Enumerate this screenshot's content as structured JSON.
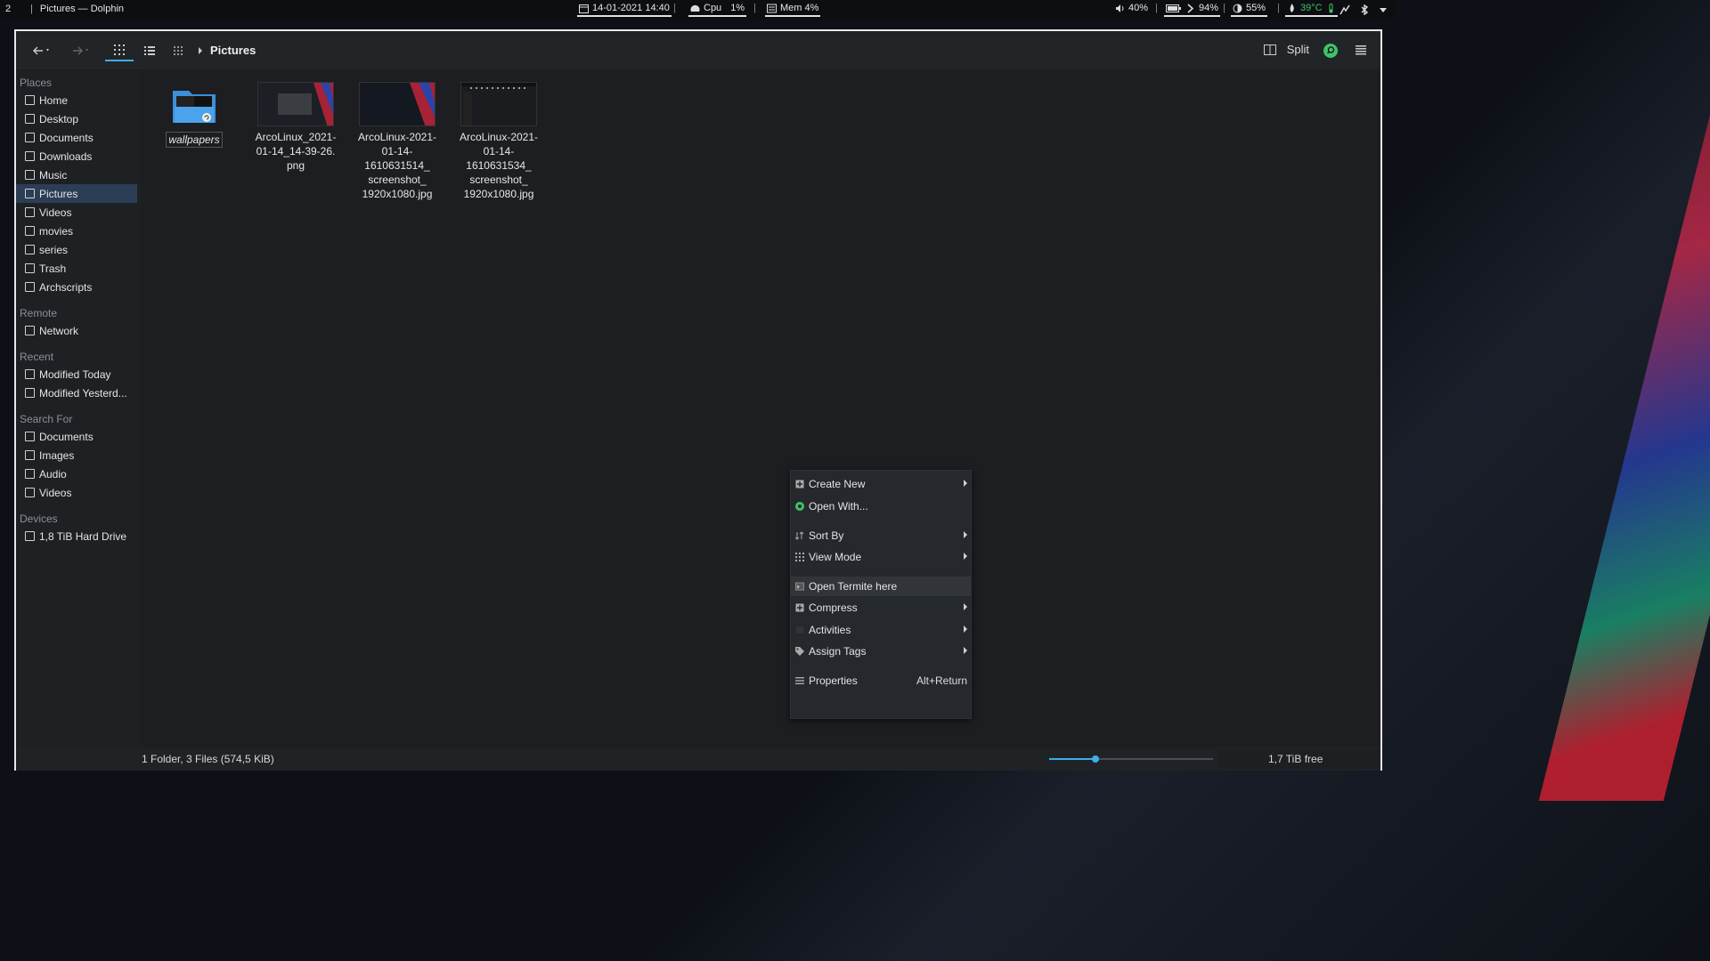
{
  "topbar": {
    "workspace": "2",
    "window_title": "Pictures — Dolphin",
    "date": "14-01-2021 14:40",
    "cpu_label": "Cpu",
    "cpu_value": "1%",
    "mem": "Mem 4%",
    "volume": "40%",
    "battery": "94%",
    "brightness": "55%",
    "temperature": "39°C",
    "temperature_color": "#3ec36b"
  },
  "toolbar": {
    "breadcrumb": "Pictures",
    "split_label": "Split"
  },
  "sidebar": {
    "places_title": "Places",
    "places": [
      {
        "label": "Home",
        "icon": "home-icon"
      },
      {
        "label": "Desktop",
        "icon": "desktop-icon"
      },
      {
        "label": "Documents",
        "icon": "document-icon"
      },
      {
        "label": "Downloads",
        "icon": "download-icon"
      },
      {
        "label": "Music",
        "icon": "music-icon"
      },
      {
        "label": "Pictures",
        "icon": "image-icon",
        "selected": true
      },
      {
        "label": "Videos",
        "icon": "video-icon"
      },
      {
        "label": "movies",
        "icon": "folder-icon"
      },
      {
        "label": "series",
        "icon": "folder-icon"
      },
      {
        "label": "Trash",
        "icon": "trash-icon"
      },
      {
        "label": "Archscripts",
        "icon": "folder-icon"
      }
    ],
    "remote_title": "Remote",
    "remote": [
      {
        "label": "Network",
        "icon": "network-icon"
      }
    ],
    "recent_title": "Recent",
    "recent": [
      {
        "label": "Modified Today",
        "icon": "calendar-icon"
      },
      {
        "label": "Modified Yesterd...",
        "icon": "calendar-icon"
      }
    ],
    "search_title": "Search For",
    "search": [
      {
        "label": "Documents",
        "icon": "document-icon"
      },
      {
        "label": "Images",
        "icon": "image-icon"
      },
      {
        "label": "Audio",
        "icon": "music-icon"
      },
      {
        "label": "Videos",
        "icon": "video-icon"
      }
    ],
    "devices_title": "Devices",
    "devices": [
      {
        "label": "1,8 TiB Hard Drive",
        "icon": "harddrive-icon"
      }
    ]
  },
  "files": [
    {
      "name": "wallpapers",
      "type": "folder"
    },
    {
      "name": "ArcoLinux_2021-01-14_14-39-26.png",
      "lines": [
        "ArcoLinux_2021-",
        "01-14_14-39-26.",
        "png"
      ]
    },
    {
      "name": "ArcoLinux-2021-01-14-1610631514_screenshot_1920x1080.jpg",
      "lines": [
        "ArcoLinux-2021-",
        "01-14-",
        "1610631514_",
        "screenshot_",
        "1920x1080.jpg"
      ]
    },
    {
      "name": "ArcoLinux-2021-01-14-1610631534_screenshot_1920x1080.jpg",
      "lines": [
        "ArcoLinux-2021-",
        "01-14-",
        "1610631534_",
        "screenshot_",
        "1920x1080.jpg"
      ]
    }
  ],
  "status": {
    "summary": "1 Folder, 3 Files (574,5 KiB)",
    "zoom_fraction": 0.28,
    "free_space": "1,7 TiB free"
  },
  "context_menu": {
    "items": [
      {
        "label": "Create New",
        "submenu": true,
        "icon": "new-icon"
      },
      {
        "label": "Open With...",
        "submenu": false,
        "icon": "open-with-icon"
      },
      {
        "label": "Sort By",
        "submenu": true,
        "icon": "sort-icon"
      },
      {
        "label": "View Mode",
        "submenu": true,
        "icon": "grid-icon"
      },
      {
        "label": "Open Termite here",
        "submenu": false,
        "icon": "terminal-icon",
        "highlighted": true
      },
      {
        "label": "Compress",
        "submenu": true,
        "icon": "compress-icon"
      },
      {
        "label": "Activities",
        "submenu": true,
        "icon": "activities-icon"
      },
      {
        "label": "Assign Tags",
        "submenu": true,
        "icon": "tag-icon"
      },
      {
        "label": "Properties",
        "submenu": false,
        "icon": "properties-icon",
        "shortcut": "Alt+Return"
      }
    ]
  },
  "colors": {
    "accent": "#3daee9",
    "selection": "#2c3e55",
    "green": "#3ec36b"
  }
}
